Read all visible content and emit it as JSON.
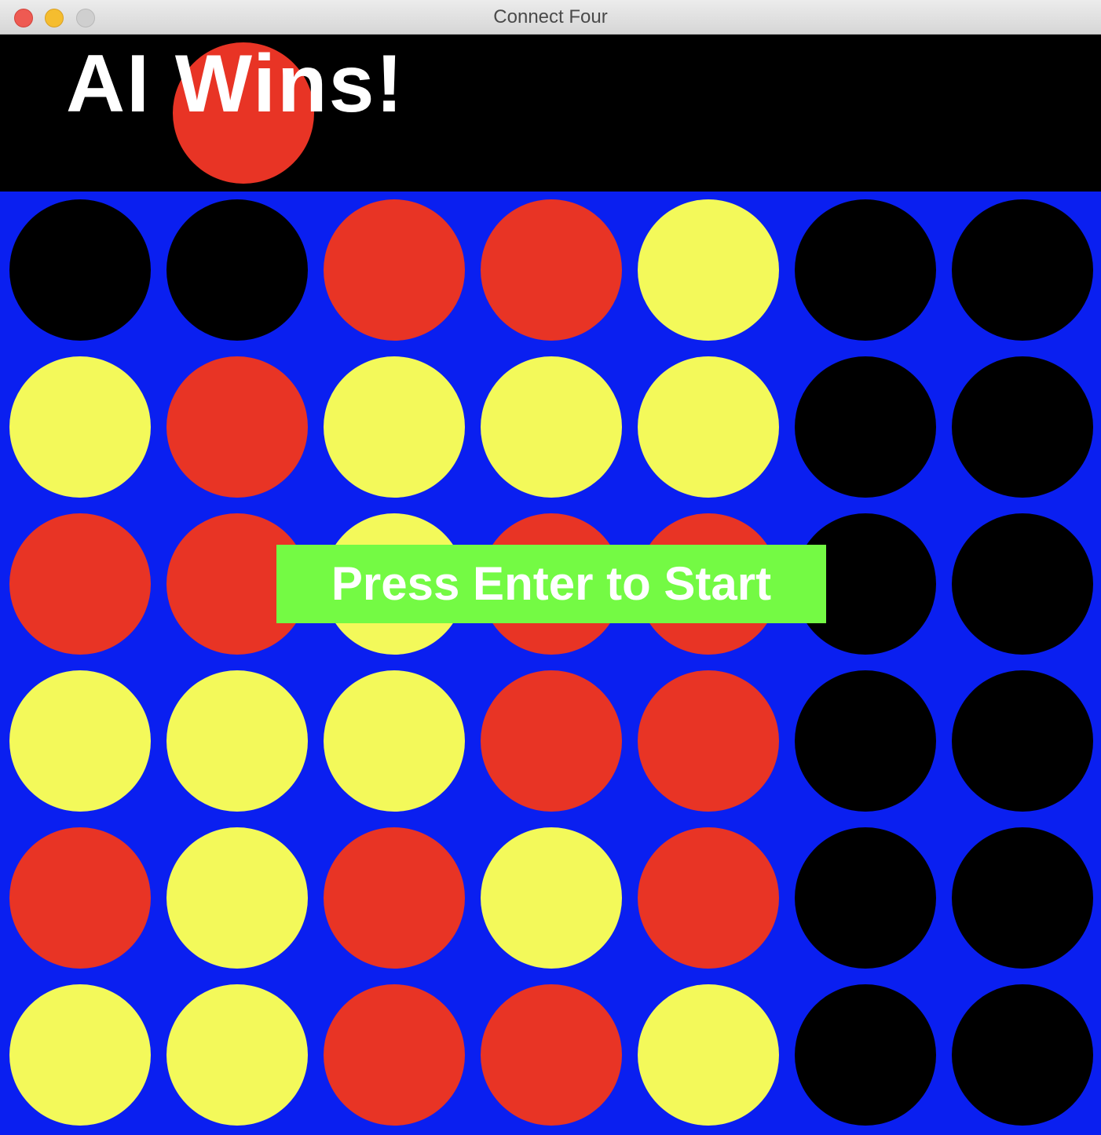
{
  "window": {
    "title": "Connect Four"
  },
  "header": {
    "status_text": "AI Wins!",
    "hover_piece": "red"
  },
  "prompt": {
    "label": "Press Enter to Start"
  },
  "colors": {
    "board": "#0a1ff0",
    "empty": "#000000",
    "red": "#e83425",
    "yellow": "#f3f95a",
    "prompt_bg": "#74fa44",
    "header_bg": "#000000"
  },
  "board": {
    "rows": 6,
    "cols": 7,
    "grid": [
      [
        "empty",
        "empty",
        "red",
        "red",
        "yellow",
        "empty",
        "empty"
      ],
      [
        "yellow",
        "red",
        "yellow",
        "yellow",
        "yellow",
        "empty",
        "empty"
      ],
      [
        "red",
        "red",
        "yellow",
        "red",
        "red",
        "empty",
        "empty"
      ],
      [
        "yellow",
        "yellow",
        "yellow",
        "red",
        "red",
        "empty",
        "empty"
      ],
      [
        "red",
        "yellow",
        "red",
        "yellow",
        "red",
        "empty",
        "empty"
      ],
      [
        "yellow",
        "yellow",
        "red",
        "red",
        "yellow",
        "empty",
        "empty"
      ]
    ]
  }
}
